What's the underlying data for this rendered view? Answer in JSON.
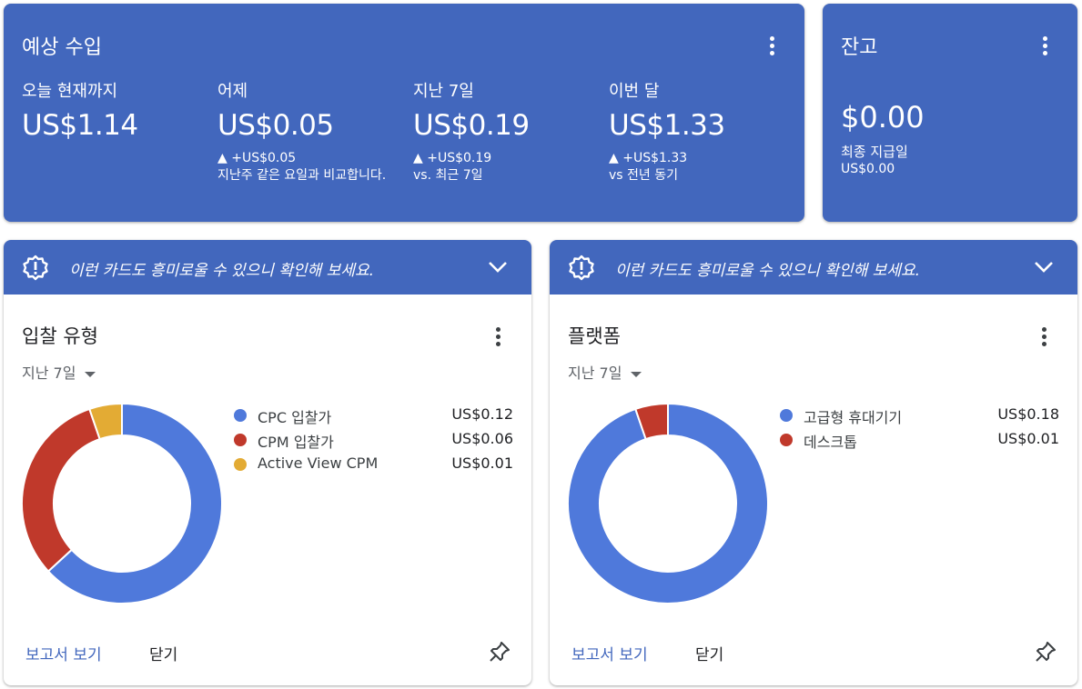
{
  "earnings": {
    "title": "예상 수입",
    "metrics": [
      {
        "label": "오늘 현재까지",
        "value": "US$1.14",
        "delta": "",
        "note": ""
      },
      {
        "label": "어제",
        "value": "US$0.05",
        "delta": "▲ +US$0.05",
        "note": "지난주 같은 요일과 비교합니다."
      },
      {
        "label": "지난 7일",
        "value": "US$0.19",
        "delta": "▲ +US$0.19",
        "note": "vs. 최근 7일"
      },
      {
        "label": "이번 달",
        "value": "US$1.33",
        "delta": "▲ +US$1.33",
        "note": "vs 전년 동기"
      }
    ]
  },
  "balance": {
    "title": "잔고",
    "value": "$0.00",
    "last_payment_label": "최종 지급일",
    "last_payment_value": "US$0.00"
  },
  "colors": {
    "brand_blue": "#4267bd",
    "series_blue": "#4f79db",
    "series_red": "#c0392b",
    "series_yellow": "#e3ab34"
  },
  "bid_card": {
    "banner_text": "이런 카드도 흥미로울 수 있으니 확인해 보세요.",
    "title": "입찰 유형",
    "period": "지난 7일",
    "view_report": "보고서 보기",
    "dismiss": "닫기",
    "chart_data": {
      "type": "pie",
      "categories": [
        "CPC 입찰가",
        "CPM 입찰가",
        "Active View CPM"
      ],
      "values": [
        0.12,
        0.06,
        0.01
      ],
      "value_labels": [
        "US$0.12",
        "US$0.06",
        "US$0.01"
      ],
      "colors": [
        "#4f79db",
        "#c0392b",
        "#e3ab34"
      ],
      "title": "",
      "donut": true
    }
  },
  "platform_card": {
    "banner_text": "이런 카드도 흥미로울 수 있으니 확인해 보세요.",
    "title": "플랫폼",
    "period": "지난 7일",
    "view_report": "보고서 보기",
    "dismiss": "닫기",
    "chart_data": {
      "type": "pie",
      "categories": [
        "고급형 휴대기기",
        "데스크톱"
      ],
      "values": [
        0.18,
        0.01
      ],
      "value_labels": [
        "US$0.18",
        "US$0.01"
      ],
      "colors": [
        "#4f79db",
        "#c0392b"
      ],
      "title": "",
      "donut": true
    }
  }
}
